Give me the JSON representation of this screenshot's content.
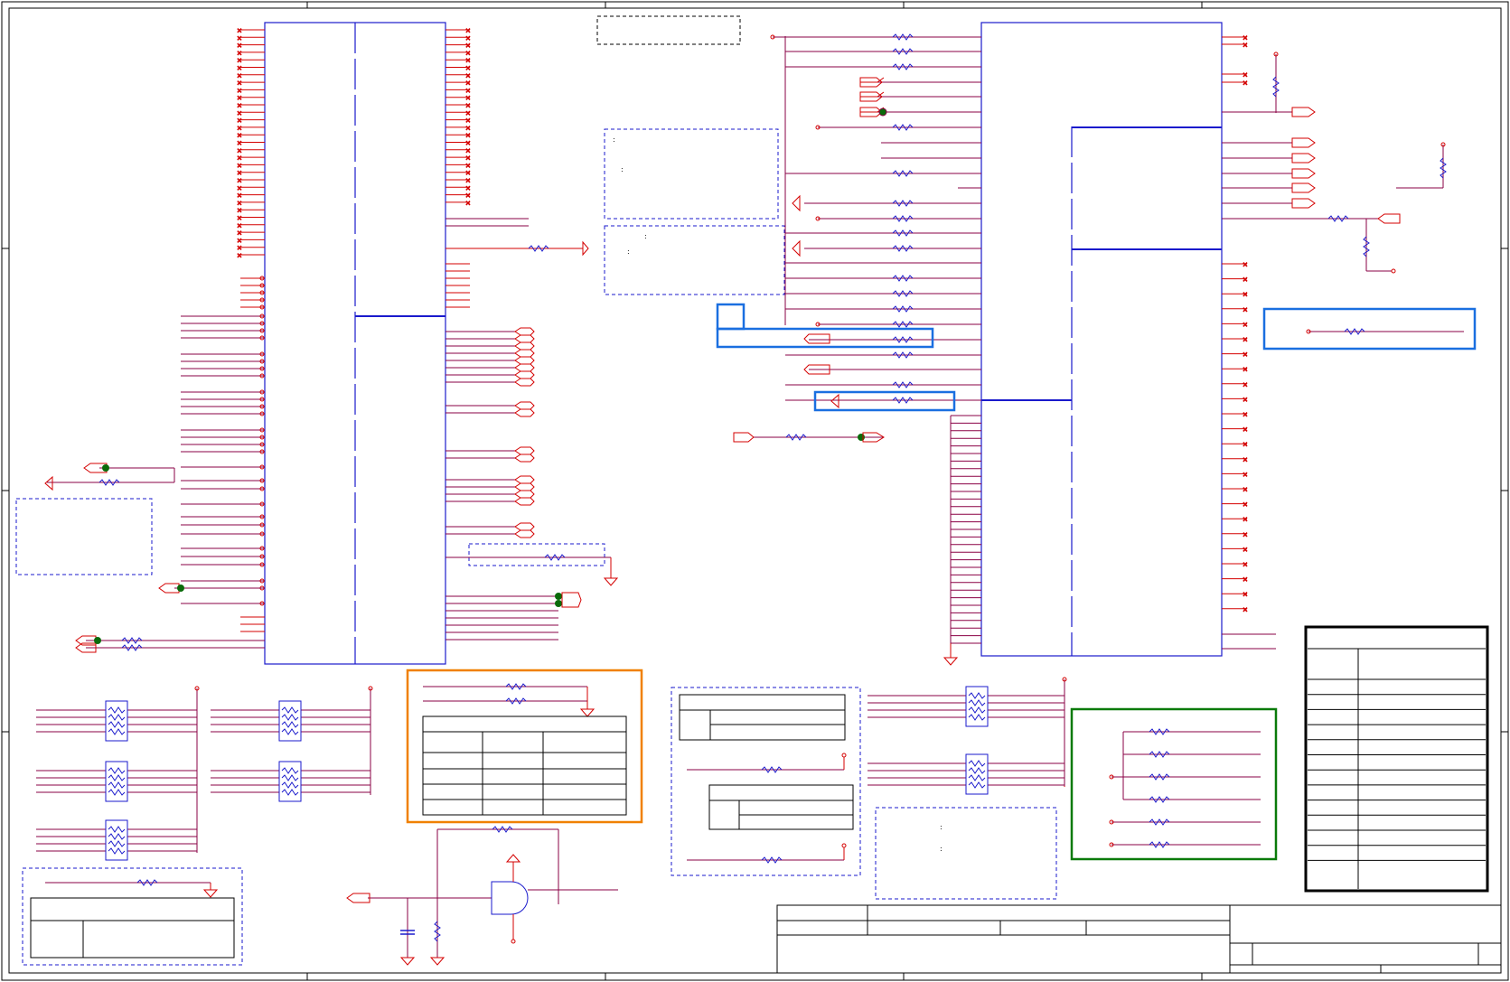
{
  "sheet": {
    "title": "",
    "drawing_type": "schematic",
    "width_label": "",
    "frame_color": "#000000"
  },
  "colors": {
    "wire_red": "#d40000",
    "net_purple": "#8a0044",
    "part_blue": "#1a1acc",
    "box_blue": "#1a6fe0",
    "box_orange": "#f08000",
    "box_green": "#0a7a0a",
    "junction_green": "#0a6a0a",
    "dashed_navy": "#1a1acc"
  },
  "icons": {
    "resistor": "resistor-icon",
    "resistor_pack": "resistor-pack-icon",
    "ground": "ground-icon",
    "power": "power-arrow-icon",
    "offpage": "offpage-connector-icon",
    "and_gate": "and-gate-icon",
    "capacitor": "capacitor-icon"
  },
  "texts": {
    "note_marks": [
      ":",
      ":",
      ":",
      ":",
      ":",
      ":"
    ]
  }
}
